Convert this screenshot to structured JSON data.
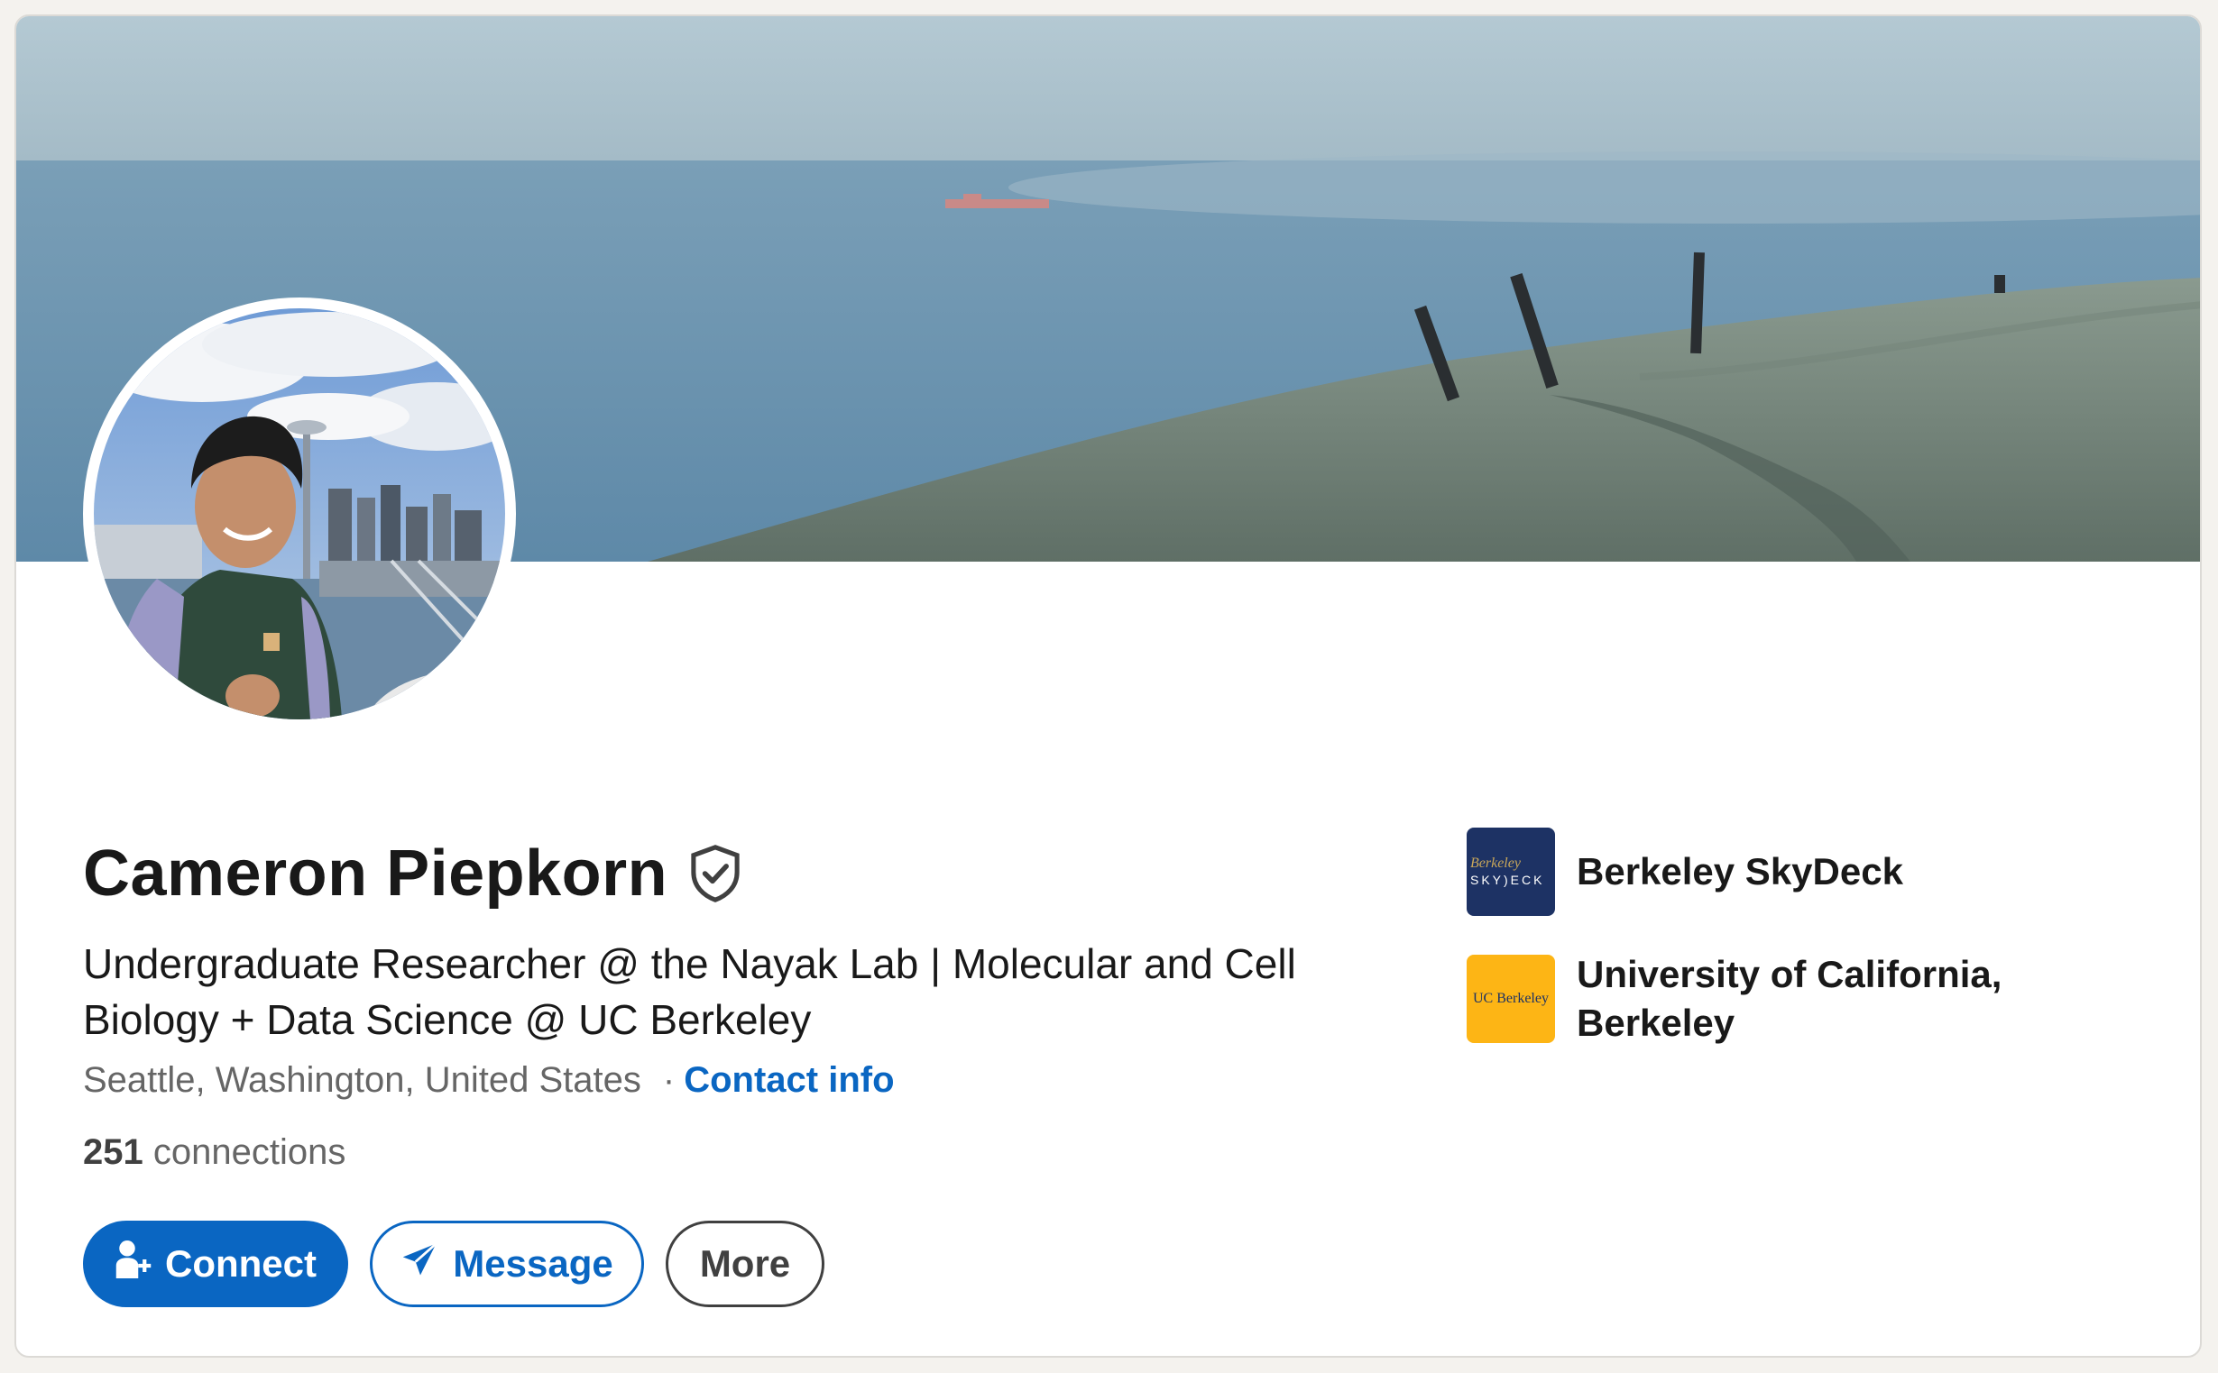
{
  "profile": {
    "name": "Cameron Piepkorn",
    "headline": "Undergraduate Researcher @ the Nayak Lab | Molecular and Cell Biology + Data Science @ UC Berkeley",
    "location": "Seattle, Washington, United States",
    "separator": "·",
    "contact_info_label": "Contact info",
    "connections_count": "251",
    "connections_label": "connections"
  },
  "actions": {
    "connect_label": "Connect",
    "message_label": "Message",
    "more_label": "More"
  },
  "organizations": [
    {
      "name": "Berkeley SkyDeck",
      "logo_line1": "Berkeley",
      "logo_line2": "SKY)ECK"
    },
    {
      "name": "University of California, Berkeley",
      "logo_text": "UC Berkeley"
    }
  ],
  "icons": {
    "verified": "shield-check-icon",
    "connect": "add-person-icon",
    "message": "paper-plane-icon"
  },
  "colors": {
    "accent": "#0a66c2",
    "text_primary": "#191919",
    "text_secondary": "#666666",
    "skydeck_bg": "#1d3264",
    "ucb_gold": "#fdb515"
  }
}
